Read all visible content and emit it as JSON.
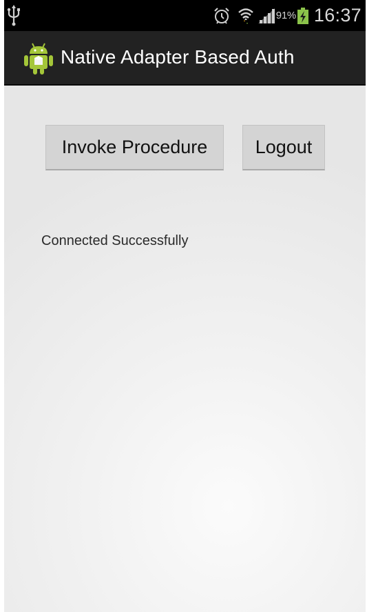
{
  "status_bar": {
    "battery_percent": "91%",
    "time": "16:37",
    "icons": [
      "usb-icon",
      "alarm-icon",
      "wifi-icon",
      "signal-icon",
      "battery-charging-icon"
    ]
  },
  "action_bar": {
    "title": "Native Adapter Based Auth",
    "icon": "android-app-icon"
  },
  "main": {
    "invoke_button_label": "Invoke Procedure",
    "logout_button_label": "Logout",
    "status_message": "Connected Successfully"
  },
  "colors": {
    "status_bar": "#000000",
    "action_bar": "#222222",
    "button_bg": "#d4d4d4",
    "android_green": "#a4c639"
  }
}
